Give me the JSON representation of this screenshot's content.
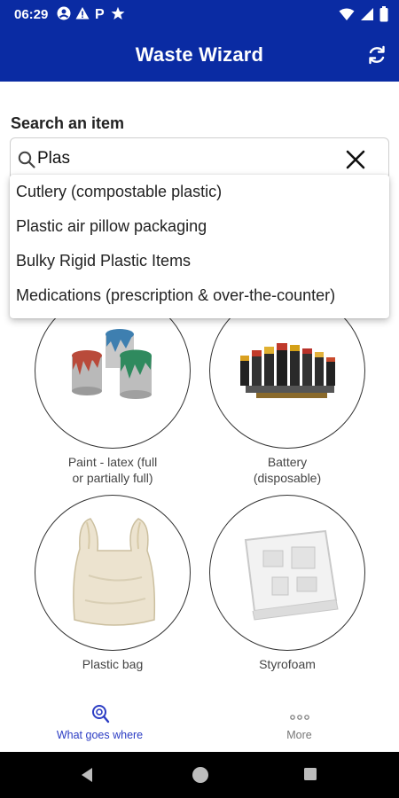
{
  "status_bar": {
    "time": "06:29",
    "left_icons": [
      "account-icon",
      "warning-icon",
      "parking-icon",
      "star-icon"
    ],
    "right_icons": [
      "wifi-icon",
      "signal-icon",
      "battery-icon"
    ]
  },
  "app_bar": {
    "title": "Waste Wizard",
    "refresh_icon": "refresh-icon"
  },
  "search": {
    "label": "Search an item",
    "value": "Plas",
    "placeholder": ""
  },
  "suggestions": [
    "Cutlery (compostable plastic)",
    "Plastic air pillow packaging",
    "Bulky Rigid Plastic Items",
    "Medications (prescription & over-the-counter)"
  ],
  "items": [
    {
      "label": "Paint - latex (full or partially full)",
      "label_line1": "Paint - latex (full",
      "label_line2": "or partially full)"
    },
    {
      "label": "Battery (disposable)",
      "label_line1": "Battery",
      "label_line2": "(disposable)"
    },
    {
      "label": "Plastic bag",
      "label_line1": "Plastic bag",
      "label_line2": ""
    },
    {
      "label": "Styrofoam",
      "label_line1": "Styrofoam",
      "label_line2": ""
    }
  ],
  "bottom_nav": [
    {
      "label": "What goes where",
      "icon": "search-recycle-icon",
      "active": true
    },
    {
      "label": "More",
      "icon": "more-icon",
      "active": false
    }
  ],
  "colors": {
    "primary": "#0a2ba3",
    "nav_active": "#2c3dc4",
    "nav_inactive": "#777777"
  }
}
